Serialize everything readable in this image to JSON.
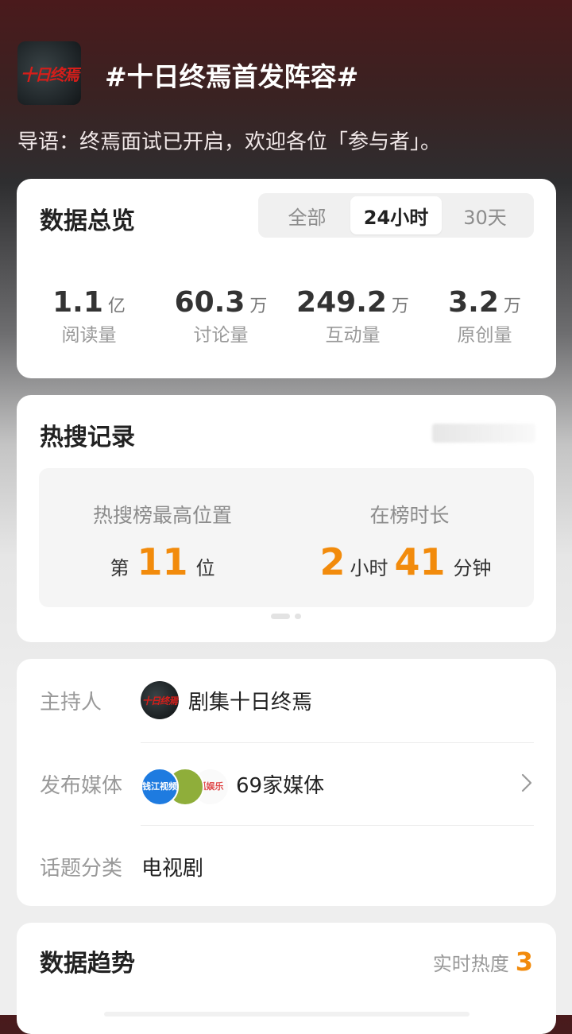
{
  "header": {
    "cover_text": "十日终焉",
    "title": "#十日终焉首发阵容#",
    "intro": "导语：终焉面试已开启，欢迎各位「参与者」。"
  },
  "overview": {
    "title": "数据总览",
    "tabs": [
      {
        "label": "全部",
        "active": false
      },
      {
        "label": "24小时",
        "active": true
      },
      {
        "label": "30天",
        "active": false
      }
    ],
    "stats": [
      {
        "value": "1.1",
        "unit": "亿",
        "label": "阅读量"
      },
      {
        "value": "60.3",
        "unit": "万",
        "label": "讨论量"
      },
      {
        "value": "249.2",
        "unit": "万",
        "label": "互动量"
      },
      {
        "value": "3.2",
        "unit": "万",
        "label": "原创量"
      }
    ]
  },
  "hot_search": {
    "title": "热搜记录",
    "highest_label": "热搜榜最高位置",
    "highest_prefix": "第",
    "highest_value": "11",
    "highest_suffix": "位",
    "duration_label": "在榜时长",
    "duration_hours": "2",
    "duration_hours_unit": "小时",
    "duration_minutes": "41",
    "duration_minutes_unit": "分钟"
  },
  "info": {
    "host_label": "主持人",
    "host_name": "剧集十日终焉",
    "host_avatar_text": "十日终焉",
    "media_label": "发布媒体",
    "media_avatars": [
      {
        "text": "钱江视频",
        "bg": "#1e7be0",
        "color": "#ffffff"
      },
      {
        "text": "",
        "bg": "#8fae3a",
        "color": "#ffffff"
      },
      {
        "text": "狐娱乐",
        "bg": "#fafafa",
        "color": "#e04a4a"
      }
    ],
    "media_count": "69家媒体",
    "category_label": "话题分类",
    "category_value": "电视剧"
  },
  "trend": {
    "title": "数据趋势",
    "heat_label": "实时热度",
    "heat_value": "3"
  },
  "colors": {
    "accent_orange": "#f28b0c",
    "logo_red": "#d51e1a"
  }
}
